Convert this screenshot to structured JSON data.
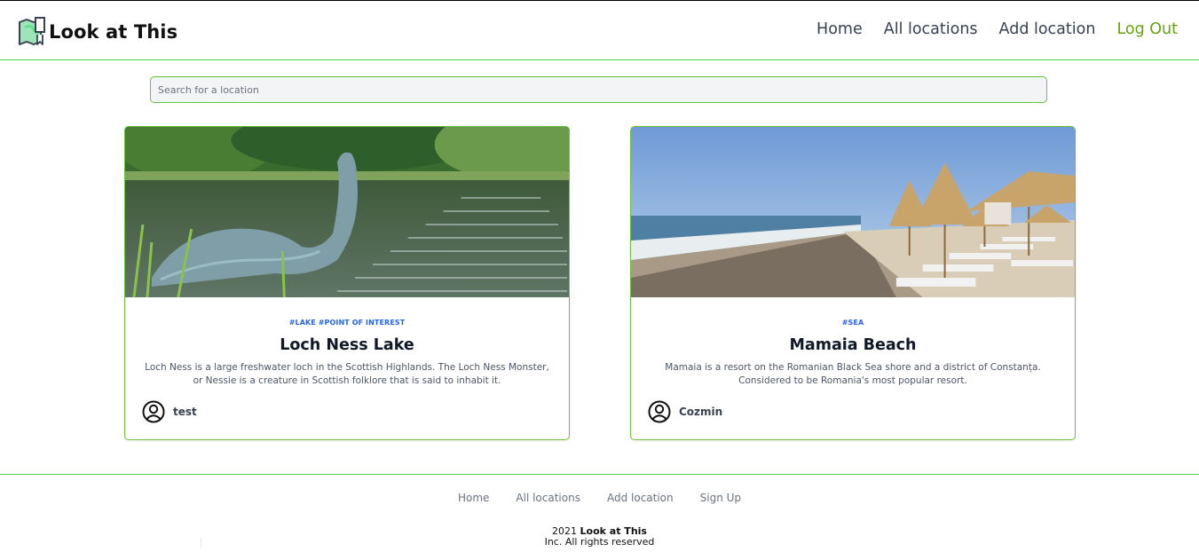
{
  "brand": {
    "name": "Look at This",
    "icon": "map-logo-icon"
  },
  "nav": {
    "home": "Home",
    "all_locations": "All locations",
    "add_location": "Add location",
    "logout": "Log Out"
  },
  "search": {
    "placeholder": "Search for a location",
    "value": ""
  },
  "cards": [
    {
      "tags": "#LAKE #POINT OF INTEREST",
      "title": "Loch Ness Lake",
      "description": "Loch Ness is a large freshwater loch in the Scottish Highlands. The Loch Ness Monster, or Nessie is a creature in Scottish folklore that is said to inhabit it.",
      "author": "test"
    },
    {
      "tags": "#SEA",
      "title": "Mamaia Beach",
      "description": "Mamaia is a resort on the Romanian Black Sea shore and a district of Constanța. Considered to be Romania's most popular resort.",
      "author": "Cozmin"
    }
  ],
  "footer": {
    "links": [
      "Home",
      "All locations",
      "Add location",
      "Sign Up"
    ],
    "copyright_year": "2021",
    "copyright_brand": "Look at This",
    "copyright_suffix": "Inc. All rights reserved"
  },
  "colors": {
    "accent_green": "#65a30d",
    "border_green": "#4ed24e",
    "tag_blue": "#2563eb"
  }
}
